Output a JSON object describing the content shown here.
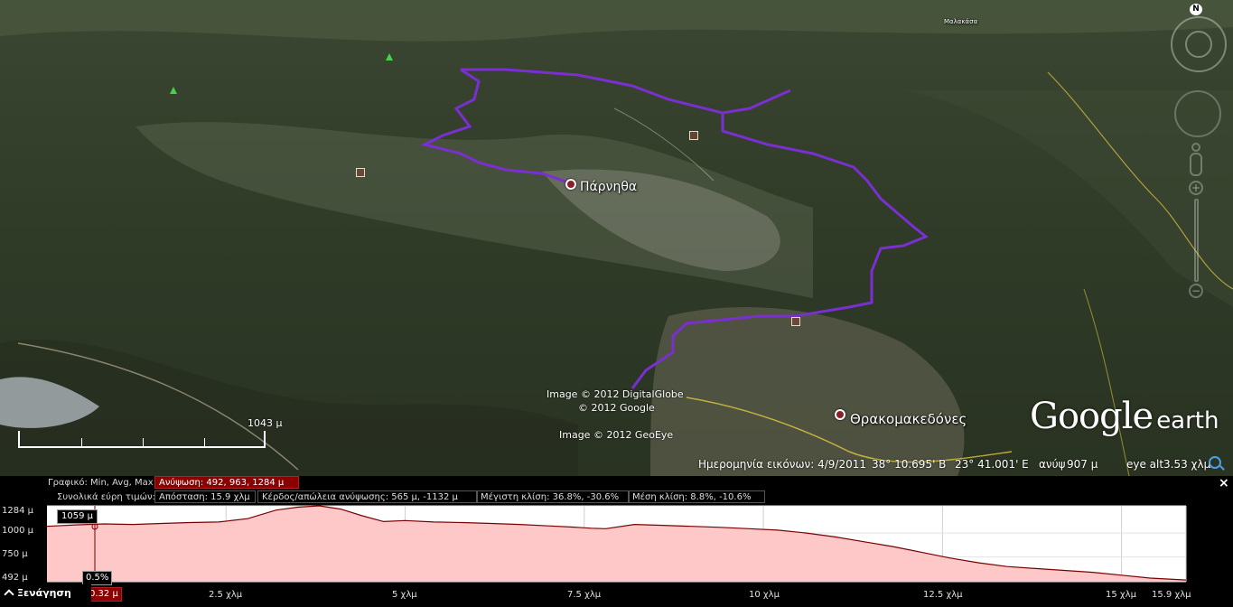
{
  "map": {
    "places": {
      "parnitha": "Πάρνηθα",
      "thrakomakedones": "Θρακομακεδόνες",
      "top_village": "Μαλακάσα"
    },
    "credits": {
      "line1": "Image © 2012 DigitalGlobe",
      "line2": "© 2012 Google",
      "line3": "Image © 2012 GeoEye"
    },
    "scale_label": "1043 μ",
    "logo": {
      "google": "Google",
      "earth": "earth"
    },
    "compass_n": "N",
    "status": {
      "imagery_date": "Ημερομηνία εικόνων: 4/9/2011",
      "lat": "38° 10.695' Β",
      "lon": "23° 41.001' Ε",
      "elev_label": "ανύψ",
      "elev_value": "907 μ",
      "eye_label": "eye alt",
      "eye_value": "3.53 χλμ"
    },
    "icons": [
      "search-icon",
      "compass-icon",
      "look-icon",
      "pegman-icon",
      "zoom-plus-icon",
      "zoom-minus-icon"
    ],
    "route_color": "#7a2fd0"
  },
  "panel": {
    "graph_label": "Γραφικό: Min, Avg, Max",
    "elevation_box": "Ανύψωση: 492, 963, 1284 μ",
    "totals_label": "Συνολικά εύρη τιμών:",
    "distance_box": "Απόσταση: 15.9 χλμ",
    "gainloss_box": "Κέρδος/απώλεια ανύψωσης: 565 μ, -1132 μ",
    "maxslope_box": "Μέγιστη κλίση: 36.8%, -30.6%",
    "avgslope_box": "Μέση κλίση: 8.8%, -10.6%",
    "close_label": "×",
    "tour_label": "Ξενάγηση",
    "cursor": {
      "elevation": "1059 μ",
      "grade": "0.5%",
      "distance": "0.32 μ"
    }
  },
  "chart_data": {
    "type": "area",
    "xlabel": "",
    "ylabel": "",
    "x_ticks": [
      "2.5 χλμ",
      "5 χλμ",
      "7.5 χλμ",
      "10 χλμ",
      "12.5 χλμ",
      "15 χλμ",
      "15.9 χλμ"
    ],
    "x_tick_values": [
      2.5,
      5,
      7.5,
      10,
      12.5,
      15,
      15.9
    ],
    "y_ticks": [
      "1284 μ",
      "1000 μ",
      "750 μ",
      "492 μ"
    ],
    "y_tick_values": [
      1284,
      1000,
      750,
      492
    ],
    "xlim": [
      0,
      15.9
    ],
    "ylim": [
      492,
      1284
    ],
    "grid": true,
    "fill_color": "#ffc8c8",
    "line_color": "#7a0000",
    "series": [
      {
        "x": [
          0,
          0.4,
          0.8,
          1.2,
          1.6,
          2.0,
          2.4,
          2.8,
          3.2,
          3.5,
          3.8,
          4.1,
          4.4,
          4.7,
          5.0,
          5.4,
          5.8,
          6.2,
          6.6,
          7.0,
          7.4,
          7.6,
          7.8,
          8.2,
          8.6,
          9.0,
          9.4,
          9.8,
          10.2,
          10.6,
          11.0,
          11.4,
          11.8,
          12.2,
          12.6,
          13.0,
          13.4,
          13.8,
          14.2,
          14.6,
          15.0,
          15.4,
          15.9
        ],
        "values": [
          1070,
          1085,
          1095,
          1090,
          1100,
          1110,
          1115,
          1150,
          1240,
          1270,
          1284,
          1250,
          1180,
          1120,
          1130,
          1115,
          1110,
          1100,
          1090,
          1075,
          1060,
          1050,
          1045,
          1090,
          1080,
          1070,
          1060,
          1045,
          1030,
          1000,
          960,
          910,
          860,
          800,
          740,
          690,
          650,
          630,
          610,
          590,
          560,
          530,
          510
        ]
      }
    ]
  }
}
